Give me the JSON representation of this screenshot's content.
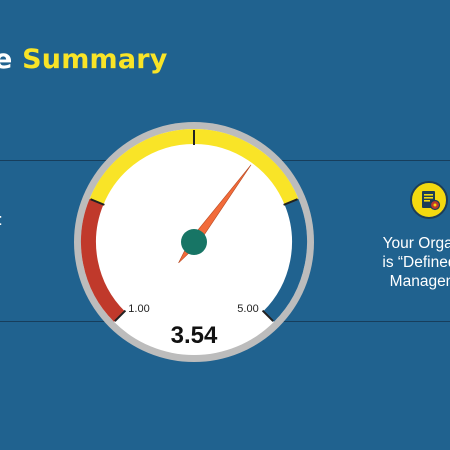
{
  "header": {
    "title_prefix": "e ",
    "title_accent": "Summary"
  },
  "left_panel": {
    "text_fragment": ":"
  },
  "right_panel": {
    "lines": [
      "Your Organ",
      "is “Defined”",
      "Managen"
    ],
    "icon": "document-gear-icon"
  },
  "gauge": {
    "min_label": "1.00",
    "max_label": "5.00",
    "reading_label": "3.54",
    "value": 3.54,
    "scale_min": 1,
    "scale_max": 5,
    "zones": [
      {
        "name": "low",
        "from": 1,
        "to": 2,
        "color": "#c0392b"
      },
      {
        "name": "mid",
        "from": 2,
        "to": 4,
        "color": "#f9e427"
      },
      {
        "name": "high",
        "from": 4,
        "to": 5,
        "color": "#20628f"
      }
    ],
    "needle_color": "#f26b3a",
    "hub_color": "#177565"
  },
  "colors": {
    "background": "#20628f",
    "accent": "#f9e427"
  }
}
